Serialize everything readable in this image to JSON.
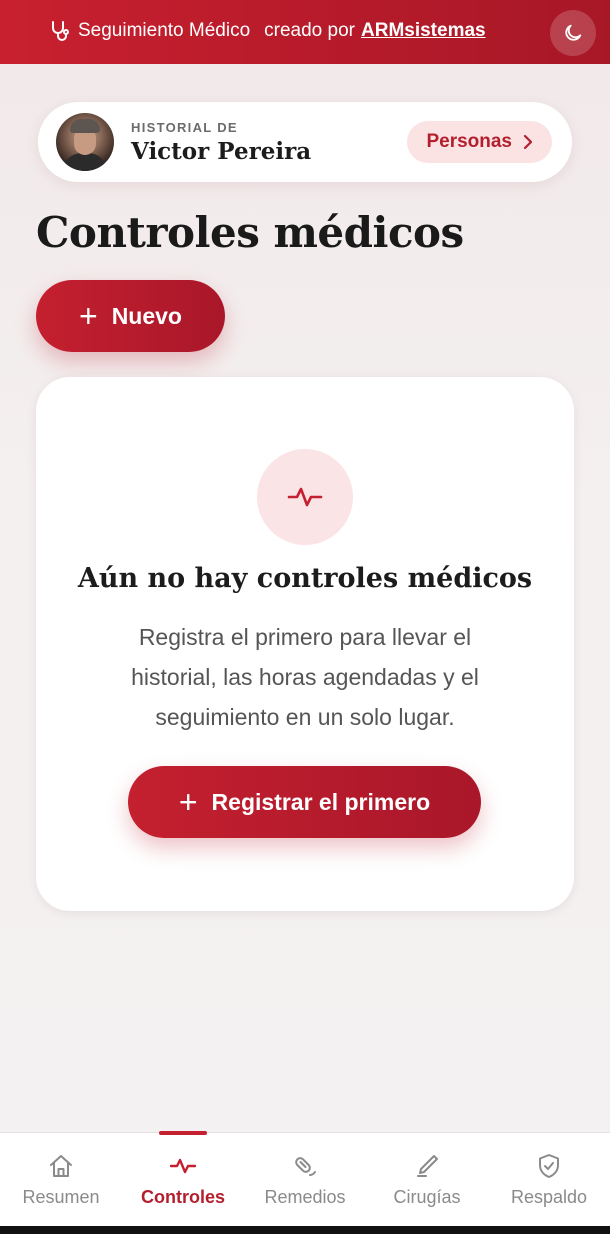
{
  "header": {
    "app_title": "Seguimiento Médico",
    "credit_prefix": "creado por",
    "credit_link": "ARMsistemas",
    "theme_icon": "moon-icon"
  },
  "profile": {
    "label": "HISTORIAL DE",
    "name": "Victor Pereira",
    "personas_button": "Personas"
  },
  "page": {
    "title": "Controles médicos",
    "new_button": "Nuevo"
  },
  "empty_state": {
    "icon": "heartbeat-icon",
    "title": "Aún no hay controles médicos",
    "description": "Registra el primero para llevar el historial, las horas agendadas y el seguimiento en un solo lugar.",
    "button": "Registrar el primero"
  },
  "nav": {
    "items": [
      {
        "label": "Resumen",
        "icon": "home-icon"
      },
      {
        "label": "Controles",
        "icon": "heartbeat-icon",
        "active": true
      },
      {
        "label": "Remedios",
        "icon": "pill-icon"
      },
      {
        "label": "Cirugías",
        "icon": "scalpel-icon"
      },
      {
        "label": "Respaldo",
        "icon": "shield-check-icon"
      }
    ]
  },
  "colors": {
    "accent": "#c4202f",
    "accent_soft": "#fbe3e4",
    "nav_inactive": "#8a8a8a"
  }
}
